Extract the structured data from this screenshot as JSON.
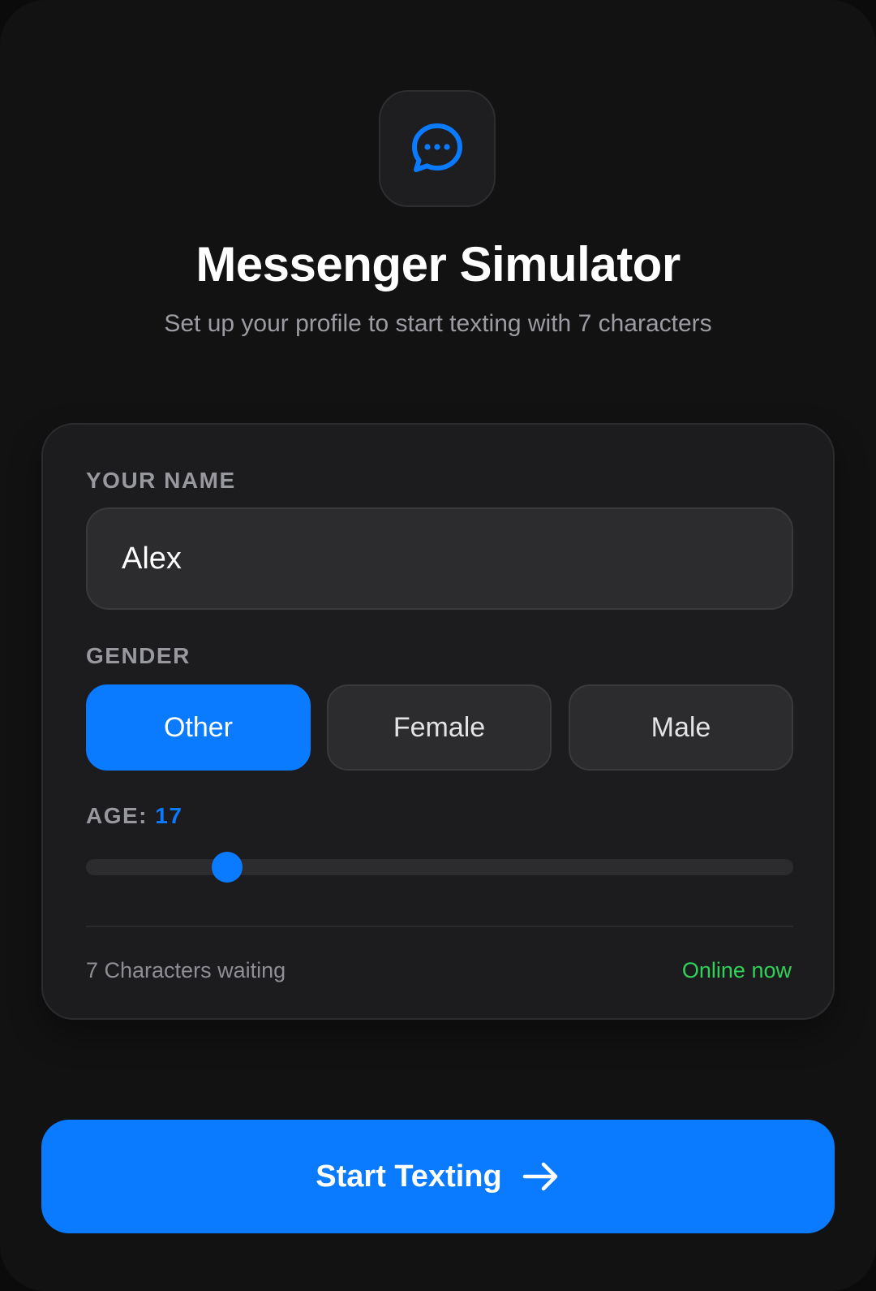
{
  "header": {
    "app_icon": "chat-bubble-dots-icon",
    "title": "Messenger Simulator",
    "subtitle": "Set up your profile to start texting with 7 characters"
  },
  "form": {
    "name": {
      "label": "YOUR NAME",
      "value": "Alex"
    },
    "gender": {
      "label": "GENDER",
      "options": [
        "Other",
        "Female",
        "Male"
      ],
      "selected": "Other"
    },
    "age": {
      "label": "AGE:",
      "value": "17",
      "slider_fraction": 0.2
    }
  },
  "status": {
    "waiting_text": "7 Characters waiting",
    "online_text": "Online now"
  },
  "cta": {
    "label": "Start Texting",
    "icon": "arrow-right-icon"
  },
  "colors": {
    "accent": "#0a7aff",
    "online": "#30d158",
    "background": "#121213",
    "card": "#1c1c1e"
  }
}
